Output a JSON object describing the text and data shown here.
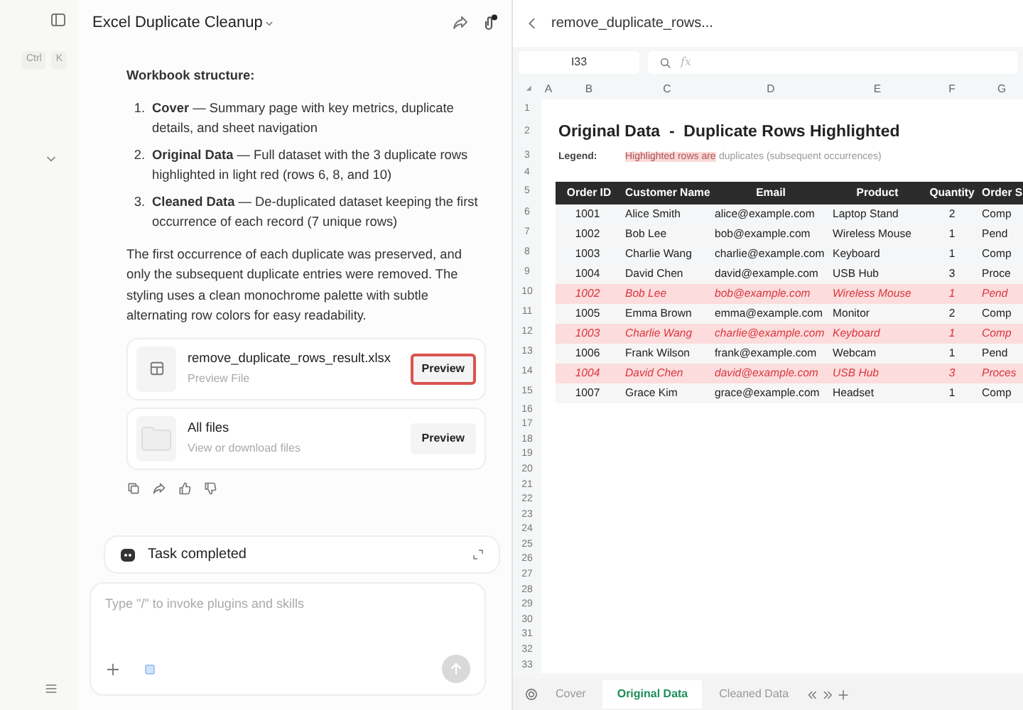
{
  "sidebar": {
    "shortcut_keys": [
      "Ctrl",
      "K"
    ]
  },
  "chat": {
    "title": "Excel Duplicate Cleanup",
    "heading": "Workbook structure:",
    "list": [
      {
        "number": "1.",
        "text": "**Cover** — Summary page with key metrics, duplicate details, and sheet navigation"
      },
      {
        "number": "2.",
        "text": "**Original Data** — Full dataset with the 3 duplicate rows highlighted in light red (rows 6, 8, and 10)"
      },
      {
        "number": "3.",
        "text": "**Cleaned Data** — De-duplicated dataset keeping the first occurrence of each record (7 unique rows)"
      }
    ],
    "paragraph": "The first occurrence of each duplicate was preserved, and only the subsequent duplicate entries were removed. The styling uses a clean monochrome palette with subtle alternating row colors for easy readability.",
    "files": [
      {
        "kind": "file",
        "name": "remove_duplicate_rows_result.xlsx",
        "subtitle": "Preview File",
        "button": "Preview",
        "highlighted": true
      },
      {
        "kind": "folder",
        "name": "All files",
        "subtitle": "View or download files",
        "button": "Preview",
        "highlighted": false
      }
    ],
    "task": "Task completed",
    "input": {
      "placeholder": "Type \"/\" to invoke plugins and skills"
    },
    "send_button": {
      "disabled": true
    }
  },
  "spreadsheet": {
    "title": "remove_duplicate_rows...",
    "cell_ref": "I33",
    "fx": "fx",
    "column_letters": [
      "A",
      "B",
      "C",
      "D",
      "E",
      "F",
      "G"
    ],
    "row_numbers": [
      "1",
      "2",
      "3",
      "4",
      "5",
      "6",
      "7",
      "8",
      "9",
      "10",
      "11",
      "12",
      "13",
      "14",
      "15",
      "16",
      "17",
      "18",
      "19",
      "20",
      "21",
      "22",
      "23",
      "24",
      "25",
      "26",
      "27",
      "28",
      "29",
      "30",
      "31",
      "32",
      "33"
    ],
    "sheet_title": "Original Data  -  Duplicate Rows Highlighted",
    "legend_label": "Legend:",
    "legend_highlight": "Highlighted rows are",
    "legend_rest": "duplicates (subsequent occurrences)",
    "columns": [
      "Order ID",
      "Customer Name",
      "Email",
      "Product",
      "Quantity",
      "Order S"
    ],
    "rows": [
      {
        "cells": [
          "1001",
          "Alice Smith",
          "alice@example.com",
          "Laptop Stand",
          "2",
          "Comp"
        ],
        "duplicate": false
      },
      {
        "cells": [
          "1002",
          "Bob Lee",
          "bob@example.com",
          "Wireless Mouse",
          "1",
          "Pend"
        ],
        "duplicate": false
      },
      {
        "cells": [
          "1003",
          "Charlie Wang",
          "charlie@example.com",
          "Keyboard",
          "1",
          "Comp"
        ],
        "duplicate": false
      },
      {
        "cells": [
          "1004",
          "David Chen",
          "david@example.com",
          "USB Hub",
          "3",
          "Proce"
        ],
        "duplicate": false
      },
      {
        "cells": [
          "1002",
          "Bob Lee",
          "bob@example.com",
          "Wireless Mouse",
          "1",
          "Pend"
        ],
        "duplicate": true
      },
      {
        "cells": [
          "1005",
          "Emma Brown",
          "emma@example.com",
          "Monitor",
          "2",
          "Comp"
        ],
        "duplicate": false
      },
      {
        "cells": [
          "1003",
          "Charlie Wang",
          "charlie@example.com",
          "Keyboard",
          "1",
          "Comp"
        ],
        "duplicate": true
      },
      {
        "cells": [
          "1006",
          "Frank Wilson",
          "frank@example.com",
          "Webcam",
          "1",
          "Pend"
        ],
        "duplicate": false
      },
      {
        "cells": [
          "1004",
          "David Chen",
          "david@example.com",
          "USB Hub",
          "3",
          "Proces"
        ],
        "duplicate": true
      },
      {
        "cells": [
          "1007",
          "Grace Kim",
          "grace@example.com",
          "Headset",
          "1",
          "Comp"
        ],
        "duplicate": false
      }
    ],
    "sheet_tabs": [
      {
        "label": "Cover",
        "selected": false
      },
      {
        "label": "Original Data",
        "selected": true
      },
      {
        "label": "Cleaned Data",
        "selected": false
      }
    ]
  }
}
